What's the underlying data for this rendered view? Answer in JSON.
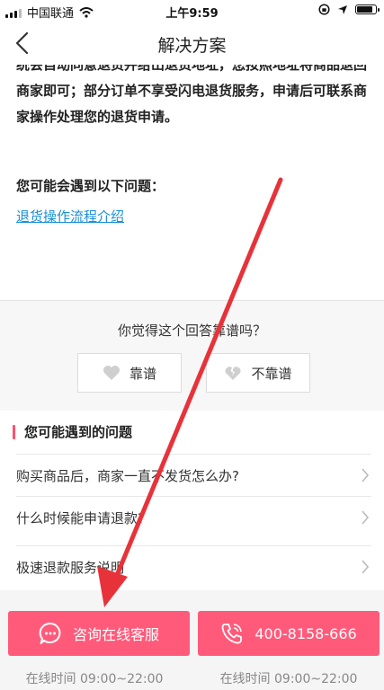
{
  "status_bar": {
    "carrier": "中国联通",
    "time": "上午9:59",
    "battery_level": 0.9
  },
  "nav": {
    "title": "解决方案",
    "back_icon": "chevron-left-icon"
  },
  "article": {
    "paragraph": "统会自动同意退货并给出退货地址，您按照地址将商品退回商家即可；部分订单不享受闪电退货服务，申请后可联系商家操作处理您的退货申请。",
    "questions_heading": "您可能会遇到以下问题：",
    "link_text": "退货操作流程介绍"
  },
  "rating": {
    "question": "你觉得这个回答靠谱吗？",
    "yes_label": "靠谱",
    "no_label": "不靠谱"
  },
  "faq": {
    "heading": "您可能遇到的问题",
    "items": [
      {
        "label": "购买商品后，商家一直不发货怎么办?"
      },
      {
        "label": "什么时候能申请退款?"
      },
      {
        "label": "极速退款服务说明"
      }
    ]
  },
  "footer": {
    "chat_label": "咨询在线客服",
    "phone_label": "400-8158-666",
    "chat_hours": "在线时间 09:00~22:00",
    "phone_hours": "在线时间 09:00~22:00"
  },
  "colors": {
    "accent": "#ff5a7a",
    "link": "#1a8fd6",
    "annotation_arrow": "#e8323a"
  }
}
